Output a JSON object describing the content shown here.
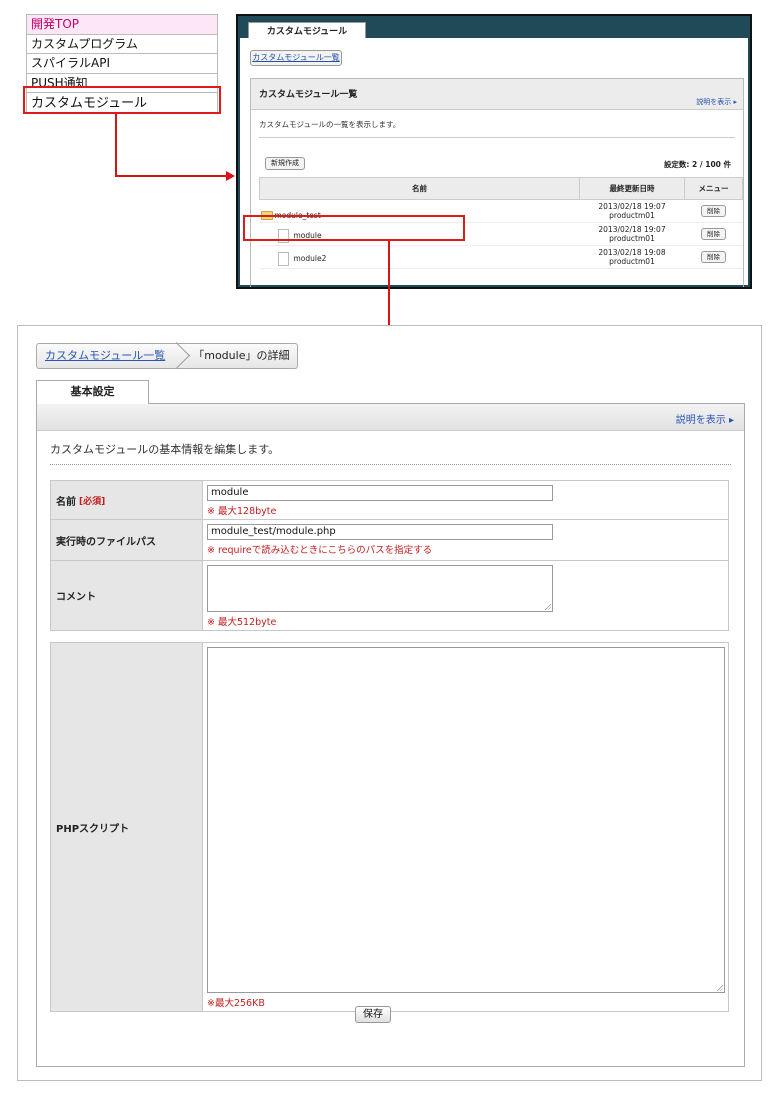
{
  "menu": {
    "items": [
      {
        "label": "開発TOP"
      },
      {
        "label": "カスタムプログラム"
      },
      {
        "label": "スパイラルAPI"
      },
      {
        "label": "PUSH通知"
      }
    ],
    "selected": "カスタムモジュール"
  },
  "list_screen": {
    "tab": "カスタムモジュール",
    "list_button": "カスタムモジュール一覧",
    "panel_title": "カスタムモジュール一覧",
    "help": "説明を表示 ▸",
    "description": "カスタムモジュールの一覧を表示します。",
    "new_button": "新規作成",
    "count": "設定数: 2 / 100 件",
    "columns": [
      "名前",
      "最終更新日時",
      "メニュー"
    ],
    "rows": [
      {
        "name": "module_test",
        "type": "folder",
        "date": "2013/02/18 19:07",
        "user": "productm01",
        "action": "削除"
      },
      {
        "name": "module",
        "type": "file",
        "date": "2013/02/18 19:07",
        "user": "productm01",
        "action": "削除"
      },
      {
        "name": "module2",
        "type": "file",
        "date": "2013/02/18 19:08",
        "user": "productm01",
        "action": "削除"
      }
    ]
  },
  "detail_screen": {
    "breadcrumb_link": "カスタムモジュール一覧",
    "breadcrumb_current": "「module」の詳細",
    "tab": "基本設定",
    "help": "説明を表示 ▸",
    "description": "カスタムモジュールの基本情報を編集します。",
    "fields": {
      "name": {
        "label": "名前",
        "required": "[必須]",
        "value": "module",
        "note": "※ 最大128byte"
      },
      "path": {
        "label": "実行時のファイルパス",
        "value": "module_test/module.php",
        "note": "※ requireで読み込むときにこちらのパスを指定する"
      },
      "comment": {
        "label": "コメント",
        "note": "※ 最大512byte"
      },
      "php": {
        "label": "PHPスクリプト",
        "note": "※最大256KB"
      }
    },
    "save_button": "保存"
  },
  "colors": {
    "highlight": "#e01a1a",
    "link": "#2a55b8",
    "note": "#c41e1e",
    "menu_top_bg": "#fde6f5"
  }
}
